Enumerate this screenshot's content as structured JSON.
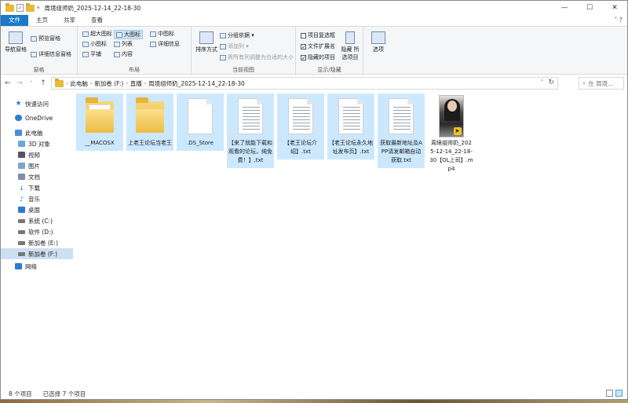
{
  "window": {
    "title": "周境组师奶_2025-12-14_22-18-30",
    "controls": {
      "minimize": "—",
      "maximize": "☐",
      "close": "✕"
    },
    "qa_dropdown": "▾"
  },
  "ribbon_tabs": [
    "文件",
    "主页",
    "共享",
    "查看"
  ],
  "ribbon_help": "˅ ?",
  "ribbon": {
    "pane": {
      "nav_pane": "导航窗格",
      "preview_pane": "预览窗格",
      "details_pane": "详细信息窗格",
      "label": "窗格"
    },
    "layout": {
      "items": [
        "超大图标",
        "大图标",
        "中图标",
        "小图标",
        "列表",
        "详细信息",
        "平铺",
        "内容"
      ],
      "selected": "大图标",
      "label": "布局"
    },
    "current_view": {
      "sort": "排序方式",
      "group_by": "分组依据 ▾",
      "add_column": "添加列 ▾",
      "fit_columns": "将所有列调整为合适的大小",
      "label": "当前视图"
    },
    "show_hide": {
      "item_checkboxes": "项目复选框",
      "file_extensions": "文件扩展名",
      "hidden_items": "隐藏的项目",
      "hide_selected": "隐藏 所选项目",
      "options": "选项",
      "label": "显示/隐藏"
    }
  },
  "address": {
    "crumbs": [
      "此电脑",
      "新加卷 (F:)",
      "直播",
      "周境组师奶_2025-12-14_22-18-30"
    ],
    "search_placeholder": "在 周境..."
  },
  "nav": [
    {
      "label": "快速访问",
      "icon": "star-icon",
      "color": "#2a7cd4"
    },
    {
      "label": "OneDrive",
      "icon": "cloud-icon",
      "color": "#2a7cd4"
    },
    {
      "label": "此电脑",
      "icon": "computer-icon",
      "color": "#4a90d9"
    },
    {
      "label": "3D 对象",
      "icon": "cube-icon",
      "color": "#6aa6e0"
    },
    {
      "label": "视频",
      "icon": "video-icon",
      "color": "#556"
    },
    {
      "label": "图片",
      "icon": "picture-icon",
      "color": "#7da4c9"
    },
    {
      "label": "文档",
      "icon": "document-icon",
      "color": "#7d8fa8"
    },
    {
      "label": "下载",
      "icon": "download-icon",
      "color": "#2a7cd4"
    },
    {
      "label": "音乐",
      "icon": "music-icon",
      "color": "#2a7cd4"
    },
    {
      "label": "桌面",
      "icon": "desktop-icon",
      "color": "#2d7bd0"
    },
    {
      "label": "系统 (C:)",
      "icon": "drive-icon",
      "color": "#777"
    },
    {
      "label": "软件 (D:)",
      "icon": "drive-icon",
      "color": "#777"
    },
    {
      "label": "新加卷 (E:)",
      "icon": "drive-icon",
      "color": "#777"
    },
    {
      "label": "新加卷 (F:)",
      "icon": "drive-icon",
      "color": "#777"
    },
    {
      "label": "网络",
      "icon": "network-icon",
      "color": "#2a7cd4"
    }
  ],
  "files": [
    {
      "name": "__MACOSX",
      "type": "folder",
      "selected": true
    },
    {
      "name": "上老王论坛当老王",
      "type": "folder",
      "selected": true
    },
    {
      "name": ".DS_Store",
      "type": "file",
      "selected": true
    },
    {
      "name": "【来了就能下载和观看的论坛，纯免费！】.txt",
      "type": "txt",
      "selected": true
    },
    {
      "name": "【老王论坛介绍】.txt",
      "type": "txt",
      "selected": true
    },
    {
      "name": "【老王论坛永久地址发布页】.txt",
      "type": "txt",
      "selected": true
    },
    {
      "name": "获取最新地址及APP请发邮箱自动获取.txt",
      "type": "txt",
      "selected": true
    },
    {
      "name": "周境组师奶_2025-12-14_22-18-30【OL上司】.mp4",
      "type": "video",
      "selected": false
    }
  ],
  "status": {
    "count": "8 个项目",
    "selected": "已选择 7 个项目"
  }
}
